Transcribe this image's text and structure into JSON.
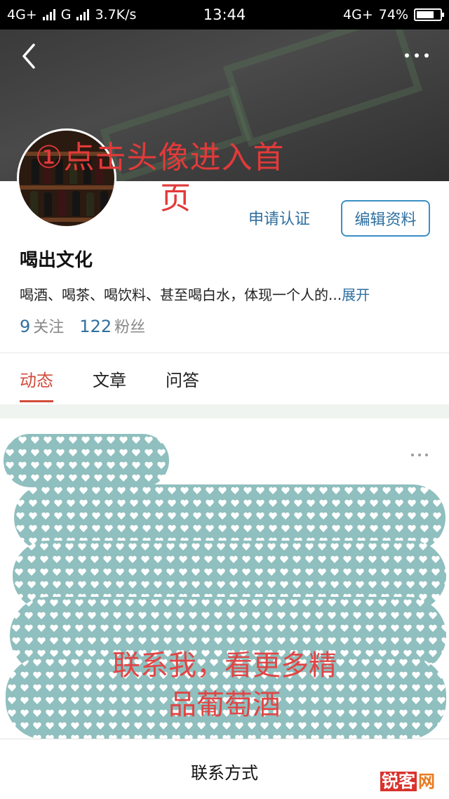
{
  "status_bar": {
    "network_left": "4G+",
    "network_g": "G",
    "speed": "3.7K/s",
    "time": "13:44",
    "network_right": "4G+",
    "battery": "74%",
    "battery_level": 0.74
  },
  "header": {
    "back_icon": "chevron-left-icon",
    "more_icon": "more-horizontal-icon"
  },
  "annotations": {
    "tip_line1": "①点击头像进入首",
    "tip_line2": "页",
    "promo_line1": "联系我，看更多精",
    "promo_line2": "品葡萄酒",
    "annotation_color": "#e23a3a"
  },
  "profile": {
    "verify_label": "申请认证",
    "edit_label": "编辑资料",
    "name": "喝出文化",
    "bio": "喝酒、喝茶、喝饮料、甚至喝白水，体现一个人的...",
    "bio_expand": "展开",
    "following_count": "9",
    "following_label": "关注",
    "followers_count": "122",
    "followers_label": "粉丝"
  },
  "tabs": [
    {
      "label": "动态",
      "active": true
    },
    {
      "label": "文章",
      "active": false
    },
    {
      "label": "问答",
      "active": false
    }
  ],
  "footer": {
    "contact_label": "联系方式",
    "watermark_brand": "锐客",
    "watermark_suffix": "网"
  },
  "colors": {
    "accent_blue": "#2f6f9f",
    "tab_active": "#d14c3b",
    "mosaic": "#8fbfbe"
  }
}
